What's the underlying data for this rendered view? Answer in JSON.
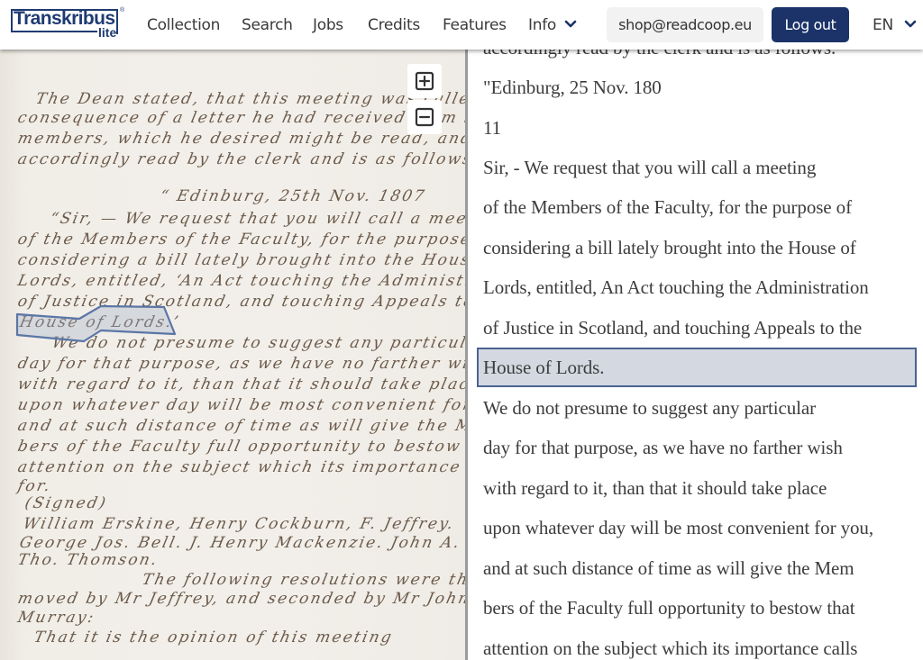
{
  "app": {
    "logo_text": "Transkribus",
    "logo_sub": "lite",
    "logo_reg": "®"
  },
  "nav": {
    "links": [
      {
        "label": "Collection"
      },
      {
        "label": "Search"
      },
      {
        "label": "Jobs"
      },
      {
        "label": "Credits"
      },
      {
        "label": "Features"
      },
      {
        "label": "Info"
      }
    ],
    "account_email": "shop@readcoop.eu",
    "logout_label": "Log out",
    "language": "EN"
  },
  "viewer": {
    "zoom_in_icon": "plus-square-icon",
    "zoom_out_icon": "minus-square-icon",
    "highlight_color": "#4a6393",
    "handwriting_lines": [
      "The Dean stated, that this meeting was called in",
      "consequence of a letter he had received from several",
      "members, which he desired might be read, and was",
      "accordingly read by the clerk and is as follows.",
      "“ Edinburg, 25th Nov. 1807",
      "“Sir, — We request that you will call a meeting",
      "of the Members of the Faculty, for the purpose of",
      "considering a bill lately brought into the House of",
      "Lords, entitled, ‘An Act touching the Administration",
      "of Justice in Scotland, and touching Appeals to the",
      "House of Lords.’",
      "We do not presume to suggest any particular",
      "day for that purpose, as we have no farther wish",
      "with regard to it, than that it should take place",
      "upon whatever day will be most convenient for you,",
      "and at such distance of time as will give the Mem-",
      "bers of the Faculty full opportunity to bestow that",
      "attention on the subject which its importance calls",
      "for.",
      "(Signed)",
      "William Erskine, Henry Cockburn,   F. Jeffrey.",
      "George Jos. Bell.  J. Henry Mackenzie.  John A. Murray",
      "Tho. Thomson.",
      "The following resolutions were then",
      "moved by Mr Jeffrey, and seconded by Mr John",
      "Murray:",
      "That it is the opinion of this meeting"
    ]
  },
  "transcription": {
    "partial_top_line": "accordingly read by the clerk and is as follows.",
    "lines": [
      "\"Edinburg, 25 Nov. 180",
      "11",
      "Sir, - We request that you will call a meeting",
      "of the Members of the Faculty, for the purpose of",
      "considering a bill lately brought into the House of",
      "Lords, entitled, An Act touching the Administration",
      "of Justice in Scotland, and touching Appeals to the",
      "House of Lords.",
      "We do not presume to suggest any particular",
      "day for that purpose, as we have no farther wish",
      "with regard to it, than that it should take place",
      "upon whatever day will be most convenient for you,",
      "and at such distance of time as will give the Mem",
      "bers of the Faculty full opportunity to bestow that",
      "attention on the subject which its importance calls"
    ],
    "active_line_index": 7
  }
}
